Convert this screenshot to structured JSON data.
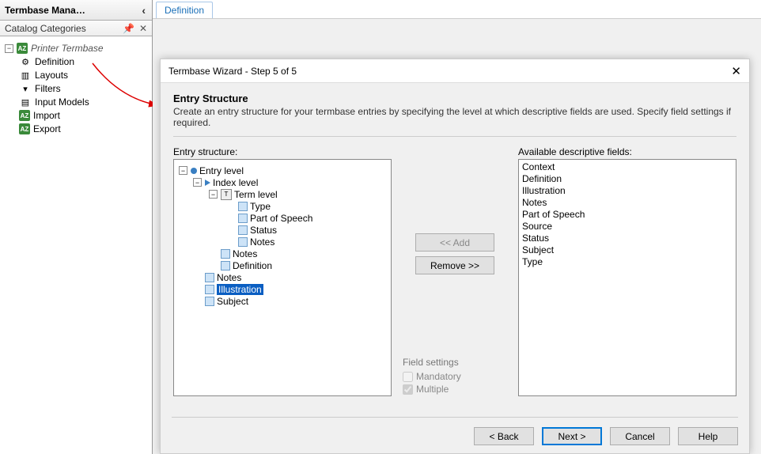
{
  "left_panel": {
    "title": "Termbase Mana…",
    "catalog_label": "Catalog Categories",
    "root": "Printer Termbase",
    "items": [
      "Definition",
      "Layouts",
      "Filters",
      "Input Models",
      "Import",
      "Export"
    ]
  },
  "tab": {
    "label": "Definition"
  },
  "wizard": {
    "title": "Termbase Wizard - Step 5 of 5",
    "heading": "Entry Structure",
    "description": "Create an entry structure for your termbase entries by specifying the level at which descriptive fields are used. Specify field settings if required.",
    "entry_structure_label": "Entry structure:",
    "available_label": "Available descriptive fields:",
    "add_btn": "<< Add",
    "remove_btn": "Remove >>",
    "field_settings_label": "Field settings",
    "mandatory_label": "Mandatory",
    "multiple_label": "Multiple",
    "back_btn": "< Back",
    "next_btn": "Next >",
    "cancel_btn": "Cancel",
    "help_btn": "Help",
    "available_fields": [
      "Context",
      "Definition",
      "Illustration",
      "Notes",
      "Part of Speech",
      "Source",
      "Status",
      "Subject",
      "Type"
    ],
    "tree": {
      "entry": "Entry level",
      "index": "Index level",
      "term": "Term level",
      "term_children": [
        "Type",
        "Part of Speech",
        "Status",
        "Notes"
      ],
      "index_children": [
        "Notes",
        "Definition"
      ],
      "entry_children": [
        "Notes",
        "Illustration",
        "Subject"
      ],
      "selected": "Illustration"
    }
  }
}
